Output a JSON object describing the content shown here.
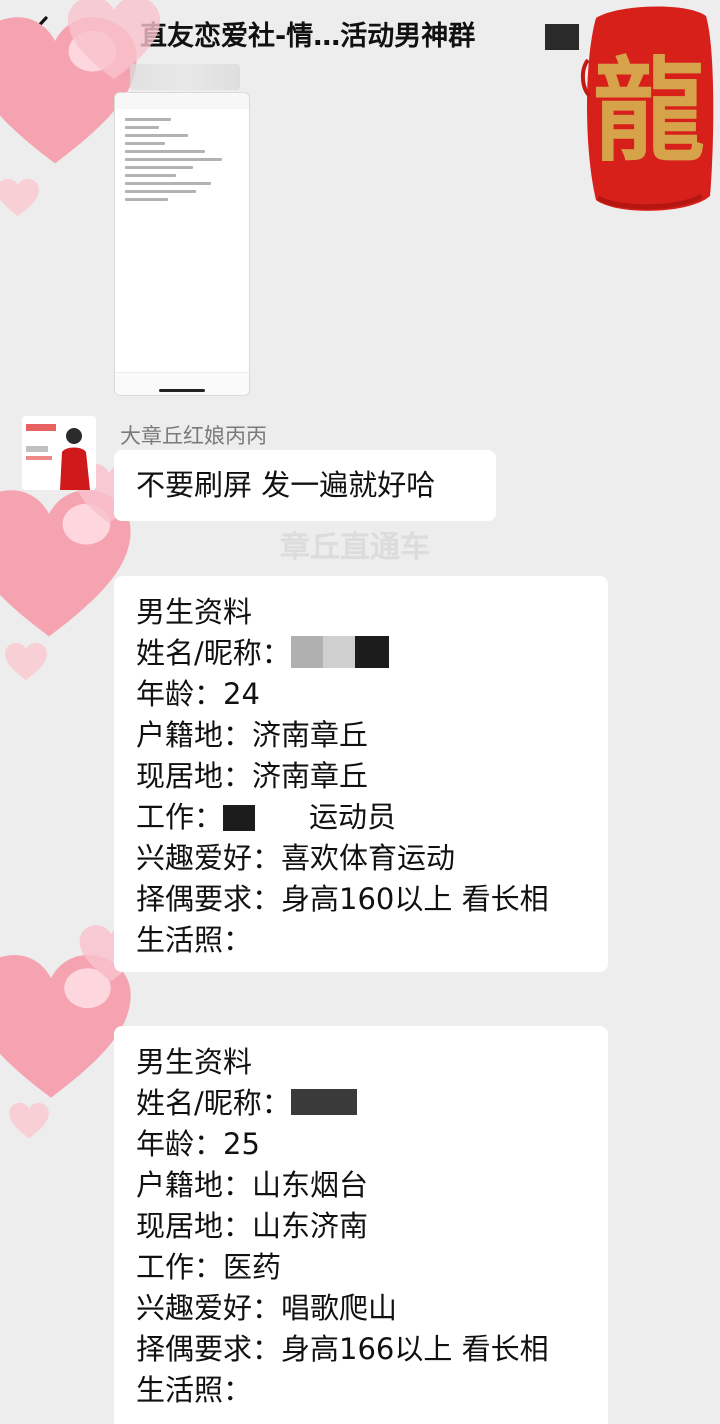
{
  "header": {
    "title": "直友恋爱社-情…活动男神群",
    "back_icon": "chevron-left-icon",
    "sticker_text": "龍"
  },
  "messages": {
    "sender_name": "大章丘红娘丙丙",
    "text": "不要刷屏   发一遍就好哈",
    "watermark": "章丘直通车"
  },
  "profile1": {
    "heading": "男生资料",
    "name_label": "姓名/昵称：",
    "age_label": "年龄：",
    "age": "24",
    "hukou_label": "户籍地：",
    "hukou": "济南章丘",
    "residence_label": "现居地：",
    "residence": "济南章丘",
    "job_label": "工作：",
    "job_suffix": "运动员",
    "hobby_label": "兴趣爱好：",
    "hobby": "喜欢体育运动",
    "req_label": "择偶要求：",
    "req": "身高160以上 看长相",
    "photo_label": "生活照："
  },
  "profile2": {
    "heading": "男生资料",
    "name_label": "姓名/昵称：",
    "age_label": "年龄：",
    "age": "25",
    "hukou_label": "户籍地：",
    "hukou": "山东烟台",
    "residence_label": "现居地：",
    "residence": "山东济南",
    "job_label": "工作：",
    "job": "医药",
    "hobby_label": "兴趣爱好：",
    "hobby": "唱歌爬山",
    "req_label": "择偶要求：",
    "req": "身高166以上 看长相",
    "photo_label": "生活照："
  },
  "colors": {
    "background": "#ededed",
    "bubble": "#ffffff",
    "heart": "#f6a9b6",
    "seal_red": "#d8201b",
    "seal_gold": "#d6a34a"
  }
}
